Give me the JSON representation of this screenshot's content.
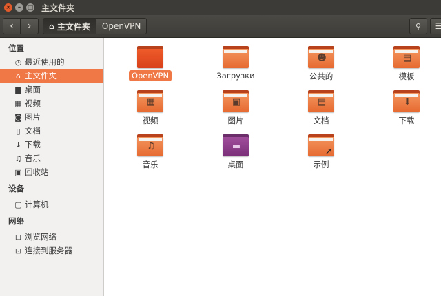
{
  "window": {
    "title": "主文件夹"
  },
  "toolbar": {
    "back_glyph": "‹",
    "forward_glyph": "›",
    "breadcrumb": [
      {
        "label": "主文件夹",
        "icon": "home-icon"
      },
      {
        "label": "OpenVPN"
      }
    ],
    "search_glyph": "⚲",
    "menu_glyph": "☰"
  },
  "sidebar": {
    "sections": [
      {
        "title": "位置",
        "items": [
          {
            "label": "最近使用的",
            "icon": "clock-icon",
            "glyph": "◷"
          },
          {
            "label": "主文件夹",
            "icon": "home-icon",
            "glyph": "⌂",
            "selected": true
          },
          {
            "label": "桌面",
            "icon": "desktop-folder-icon",
            "glyph": "▆"
          },
          {
            "label": "视频",
            "icon": "film-icon",
            "glyph": "▦"
          },
          {
            "label": "图片",
            "icon": "camera-icon",
            "glyph": "◙"
          },
          {
            "label": "文档",
            "icon": "document-icon",
            "glyph": "▯"
          },
          {
            "label": "下载",
            "icon": "download-icon",
            "glyph": "↓"
          },
          {
            "label": "音乐",
            "icon": "music-icon",
            "glyph": "♫"
          },
          {
            "label": "回收站",
            "icon": "trash-icon",
            "glyph": "▣"
          }
        ]
      },
      {
        "title": "设备",
        "items": [
          {
            "label": "计算机",
            "icon": "computer-icon",
            "glyph": "▢"
          }
        ]
      },
      {
        "title": "网络",
        "items": [
          {
            "label": "浏览网络",
            "icon": "network-icon",
            "glyph": "⊟"
          },
          {
            "label": "连接到服务器",
            "icon": "server-icon",
            "glyph": "⊡"
          }
        ]
      }
    ]
  },
  "folders": [
    {
      "label": "OpenVPN",
      "icon": "folder-icon",
      "selected": true
    },
    {
      "label": "Загрузки",
      "icon": "folder-icon"
    },
    {
      "label": "公共的",
      "icon": "public-folder-icon",
      "glyph": "☻"
    },
    {
      "label": "模板",
      "icon": "templates-folder-icon",
      "glyph": "▤"
    },
    {
      "label": "视频",
      "icon": "videos-folder-icon",
      "glyph": "▦"
    },
    {
      "label": "图片",
      "icon": "pictures-folder-icon",
      "glyph": "▣"
    },
    {
      "label": "文档",
      "icon": "documents-folder-icon",
      "glyph": "▤"
    },
    {
      "label": "下载",
      "icon": "downloads-folder-icon",
      "glyph": "⬇"
    },
    {
      "label": "音乐",
      "icon": "music-folder-icon",
      "glyph": "♫"
    },
    {
      "label": "桌面",
      "icon": "desktop-folder-icon",
      "glyph": "▬"
    },
    {
      "label": "示例",
      "icon": "examples-folder-icon",
      "glyph": "↗"
    }
  ],
  "colors": {
    "accent": "#f07746",
    "titlebar": "#3c3b37",
    "folder": "#e66a31"
  }
}
